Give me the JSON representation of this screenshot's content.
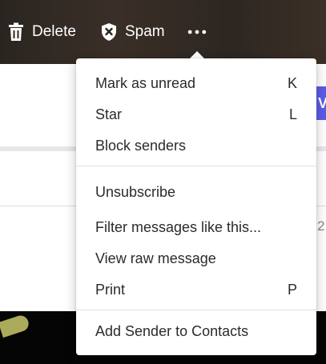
{
  "toolbar": {
    "delete_label": "Delete",
    "spam_label": "Spam",
    "more_icon": "more-horizontal-icon",
    "text_color": "#ffffff"
  },
  "background": {
    "peek_text": "2,",
    "tab_letter": "V",
    "accent_color": "#5b5ce6"
  },
  "menu": {
    "items": [
      {
        "label": "Mark as unread",
        "shortcut": "K"
      },
      {
        "label": "Star",
        "shortcut": "L"
      },
      {
        "label": "Block senders",
        "shortcut": ""
      },
      {
        "label": "Unsubscribe",
        "shortcut": ""
      },
      {
        "label": "Filter messages like this...",
        "shortcut": ""
      },
      {
        "label": "View raw message",
        "shortcut": ""
      },
      {
        "label": "Print",
        "shortcut": "P"
      },
      {
        "label": "Add Sender to Contacts",
        "shortcut": ""
      }
    ]
  }
}
